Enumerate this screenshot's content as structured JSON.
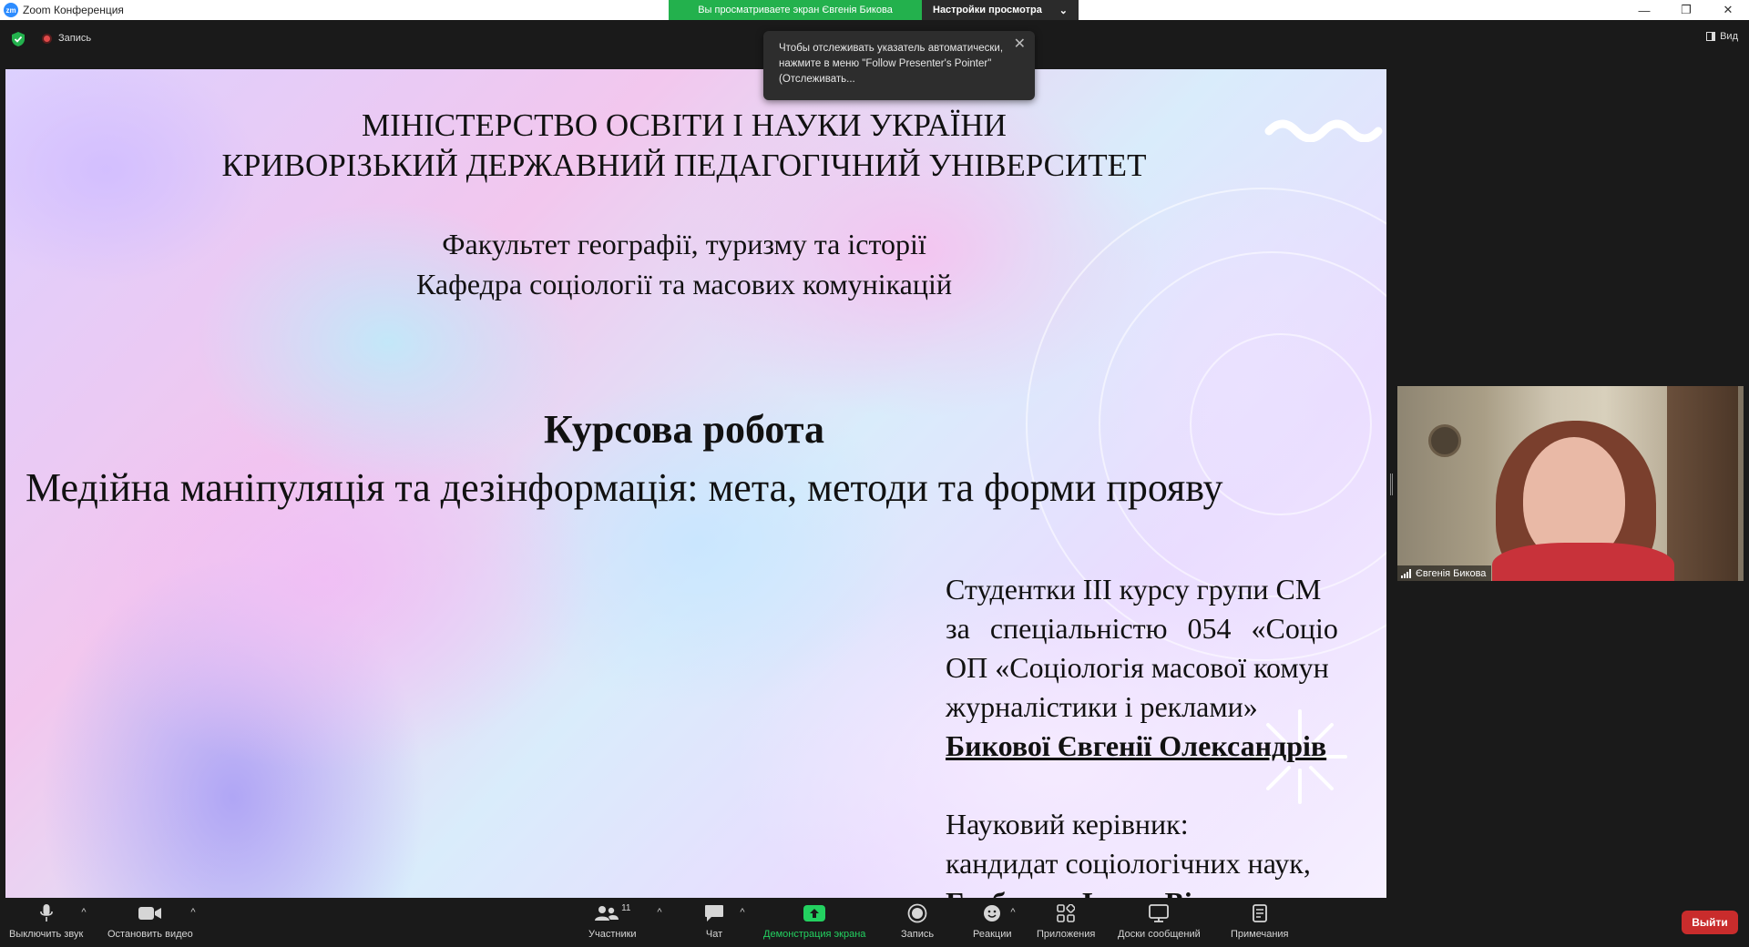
{
  "window": {
    "app_logo_text": "zm",
    "title": "Zoom Конференция",
    "minimize": "—",
    "restore": "❐",
    "close": "✕"
  },
  "share_banner": {
    "viewing": "Вы просматриваете экран Євгенія Бикова",
    "view_options": "Настройки просмотра",
    "view_options_caret": "⌄"
  },
  "top": {
    "recording": "Запись",
    "view": "Вид"
  },
  "toast": {
    "text": "Чтобы отслеживать указатель автоматически, нажмите в меню \"Follow Presenter's Pointer\" (Отслеживать...",
    "close": "✕"
  },
  "slide": {
    "ministry": "МІНІСТЕРСТВО ОСВІТИ І НАУКИ УКРАЇНИ",
    "university": "КРИВОРІЗЬКИЙ ДЕРЖАВНИЙ ПЕДАГОГІЧНИЙ УНІВЕРСИТЕТ",
    "faculty": "Факультет географії, туризму та історії",
    "department": "Кафедра соціології та масових комунікацій",
    "work_type": "Курсова робота",
    "topic": "Медійна маніпуляція та дезінформація: мета, методи та форми прояву",
    "student_lines": [
      "Студентки ІІІ курсу групи СМ",
      "за спеціальністю 054 «Соціо",
      "ОП «Соціологія масової комун",
      "журналістики і реклами»",
      "Бикової Євгенії Олександрів"
    ],
    "supervisor_label": "Науковий керівник:",
    "supervisor_degree": "кандидат соціологічних наук,",
    "supervisor_name_partial": "Гребенюк Ірина Вікто"
  },
  "video": {
    "participant_name": "Євгенія Бикова"
  },
  "toolbar": {
    "mute": "Выключить звук",
    "stop_video": "Остановить видео",
    "participants": "Участники",
    "participants_count": "11",
    "chat": "Чат",
    "share_screen": "Демонстрация экрана",
    "record": "Запись",
    "reactions": "Реакции",
    "apps": "Приложения",
    "whiteboards": "Доски сообщений",
    "notes": "Примечания",
    "leave": "Выйти",
    "caret": "^"
  },
  "colors": {
    "share_green": "#23b14d",
    "leave_red": "#c92c2c",
    "toolbar_bg": "#1a1a1a",
    "zoom_blue": "#2d8cff"
  }
}
